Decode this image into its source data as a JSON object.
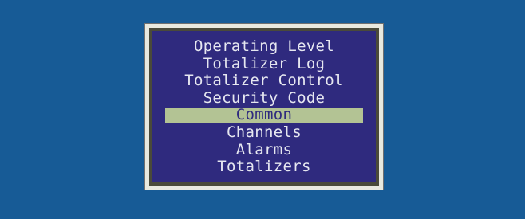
{
  "device": {
    "display": {
      "menu": {
        "items": [
          {
            "label": "Operating Level",
            "selected": false
          },
          {
            "label": "Totalizer Log",
            "selected": false
          },
          {
            "label": "Totalizer Control",
            "selected": false
          },
          {
            "label": "Security Code",
            "selected": false
          },
          {
            "label": "Common",
            "selected": true
          },
          {
            "label": "Channels",
            "selected": false
          },
          {
            "label": "Alarms",
            "selected": false
          },
          {
            "label": "Totalizers",
            "selected": false
          }
        ]
      }
    }
  },
  "colors": {
    "background": "#175b96",
    "lcd_background": "#2f2a7e",
    "lcd_text": "#e6e7f0",
    "selection_highlight": "#b3c394"
  }
}
